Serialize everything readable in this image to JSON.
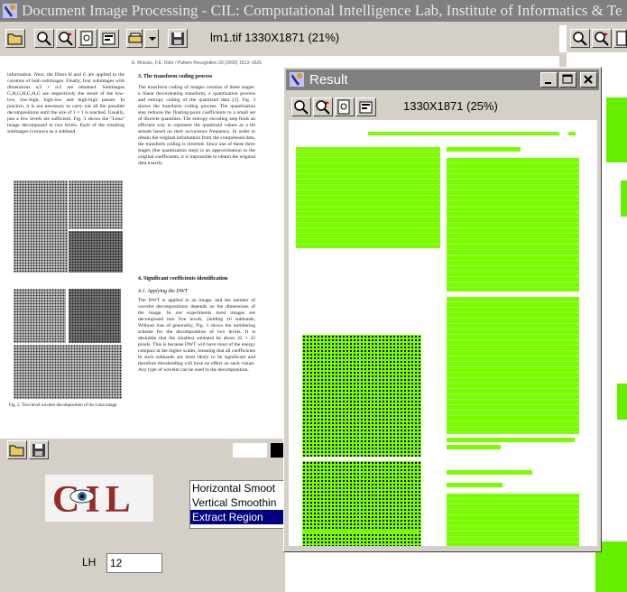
{
  "main_window": {
    "title": "Document Image Processing - CIL: Computational Intelligence Lab, Institute of Informatics & Te",
    "image_info": "lm1.tif  1330X1871  (21%)"
  },
  "document": {
    "header": "E. Moisiuc, F.E. Dobr / Pattern Recognition 33 (2000) 1613–1626",
    "left_column_text": "information. Next, the filters H and G are applied to the columns of both subimages. Finally, four subimages with dimensions n/2 × n/2 are obtained. Subimages G,H,G,H,G,H,G are respectively the result of the low-low, low-high, high-low and high-high passes. In practice, it is not necessary to carry out all the possible decompositions until the size of 1 × 1 is reached. Usually, just a few levels are sufficient. Fig. 3 shows the \"Lena\" image decomposed in two levels. Each of the resulting subimages is known as a subband.",
    "figure_caption": "Fig. 2. Two-level wavelet decomposition of the Lena image.",
    "section3_title": "3. The transform coding process",
    "section3_text": "The transform coding of images consists of three stages: a linear decorrelating transform, a quantization process and entropy coding of the quantized data [3]. Fig. 3 shows the transform coding process. The quantization step reduces the floating-point coefficients to a small set of discrete quantities. The entropy encoding step finds an efficient way to represent the quantized values as a bit stream based on their occurrence frequency. In order to obtain the original information from the compressed data, the transform coding is inverted. Since one of these three stages (the quantization step) is an approximation to the original coefficients, it is impossible to obtain the original data exactly.",
    "section4_title": "4. Significant coefficients identification",
    "section41_title": "4.1. Applying the DWT",
    "section41_text": "The DWT is applied to an image, and the number of wavelet decompositions depends on the dimensions of the image. In our experiments most images are decomposed into five levels, yielding 16 subbands. Without loss of generality, Fig. 3 shows the numbering scheme for the decomposition of two levels. It is desirable that the smallest subband be about 32 × 32 pixels. This is because DWT will have most of the energy compact at the higher scales, meaning that all coefficients in such subbands are most likely to be significant and therefore thresholding will have no effect on such values. Any type of wavelet can be used in the decomposition."
  },
  "bottom_panel": {
    "logo_text": "CIL",
    "list_items": [
      "Horizontal Smoot",
      "Vertical Smoothin",
      "Extract Region"
    ],
    "selected_item": "Extract Region",
    "lh_label": "LH",
    "lh_value": "12"
  },
  "result_window": {
    "title": "Result",
    "image_info": "1330X1871  (25%)",
    "highlight_color": "#7cfc00"
  },
  "colors": {
    "titlebar": "#808080",
    "face": "#d4d0c8",
    "selection": "#000080",
    "green": "#7cfc00"
  }
}
